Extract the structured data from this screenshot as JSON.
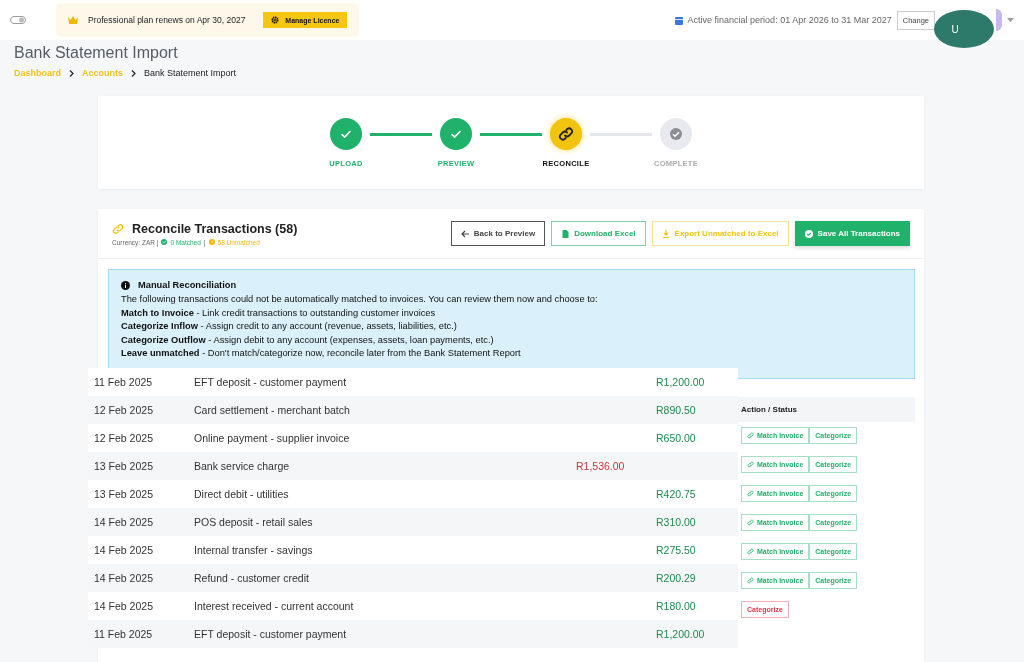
{
  "top_bar": {
    "plan_notice": "Professional plan renews on Apr 30, 2027",
    "manage_button": "Manage Licence",
    "financial_period": "Active financial period: 01 Apr 2026 to 31 Mar 2027",
    "change_button": "Change",
    "avatar": "U"
  },
  "page": {
    "title": "Bank Statement Import",
    "breadcrumbs": [
      {
        "label": "Dashboard",
        "link": true
      },
      {
        "label": "Accounts",
        "link": true
      },
      {
        "label": "Bank Statement Import",
        "link": false
      }
    ]
  },
  "steps": [
    {
      "label": "UPLOAD",
      "completed": true,
      "selected": false
    },
    {
      "label": "PREVIEW",
      "completed": true,
      "selected": false
    },
    {
      "label": "RECONCILE",
      "completed": false,
      "selected": true
    },
    {
      "label": "COMPLETE",
      "completed": false,
      "selected": false
    }
  ],
  "reconcile": {
    "title": "Reconcile Transactions (58)",
    "currency": "Currency: ZAR |",
    "matched": "0 Matched",
    "matched_sep": "|",
    "unmatched": "58 Unmatched",
    "buttons": [
      {
        "label": "Back to Preview",
        "kind": "back"
      },
      {
        "label": "Download Excel",
        "kind": "download"
      },
      {
        "label": "Export Unmatched to Excel",
        "kind": "export"
      },
      {
        "label": "Save All Transactions",
        "kind": "save"
      }
    ],
    "info": {
      "title": "Manual Reconciliation",
      "intro": "The following transactions could not be automatically matched to invoices. You can review them now and choose to:",
      "options": [
        "**Match to Invoice** - Link credit transactions to outstanding customer invoices",
        "**Categorize Inflow** - Assign credit to any account (revenue, assets, liabilities, etc.)",
        "**Categorize Outflow** - Assign debit to any account (expenses, assets, loan payments, etc.)",
        "**Leave unmatched** - Don't match/categorize now, reconcile later from the Bank Statement Report"
      ]
    },
    "action_header": "Action / Status",
    "actions": [
      {
        "match": "Match Invoice",
        "categorize": "Categorize",
        "flagged": false
      },
      {
        "match": "Match Invoice",
        "categorize": "Categorize",
        "flagged": false
      },
      {
        "match": "Match Invoice",
        "categorize": "Categorize",
        "flagged": false
      },
      {
        "match": "Match Invoice",
        "categorize": "Categorize",
        "flagged": false
      },
      {
        "match": "Match Invoice",
        "categorize": "Categorize",
        "flagged": false
      },
      {
        "match": "Match Invoice",
        "categorize": "Categorize",
        "flagged": false
      },
      {
        "categorize": "Categorize",
        "flagged": true
      }
    ]
  },
  "transactions": [
    {
      "date": "11 Feb 2025",
      "description": "EFT deposit - customer payment",
      "credit": "R1,200.00"
    },
    {
      "date": "12 Feb 2025",
      "description": "Card settlement - merchant batch",
      "credit": "R890.50"
    },
    {
      "date": "12 Feb 2025",
      "description": "Online payment - supplier invoice",
      "credit": "R650.00"
    },
    {
      "date": "13 Feb 2025",
      "description": "Bank service charge",
      "debit": "R1,536.00"
    },
    {
      "date": "13 Feb 2025",
      "description": "Direct debit - utilities",
      "credit": "R420.75"
    },
    {
      "date": "14 Feb 2025",
      "description": "POS deposit - retail sales",
      "credit": "R310.00"
    },
    {
      "date": "14 Feb 2025",
      "description": "Internal transfer - savings",
      "credit": "R275.50"
    },
    {
      "date": "14 Feb 2025",
      "description": "Refund - customer credit",
      "credit": "R200.29"
    },
    {
      "date": "14 Feb 2025",
      "description": "Interest received - current account",
      "credit": "R180.00"
    },
    {
      "date": "11 Feb 2025",
      "description": "EFT deposit - customer payment",
      "credit": "R1,200.00"
    }
  ]
}
